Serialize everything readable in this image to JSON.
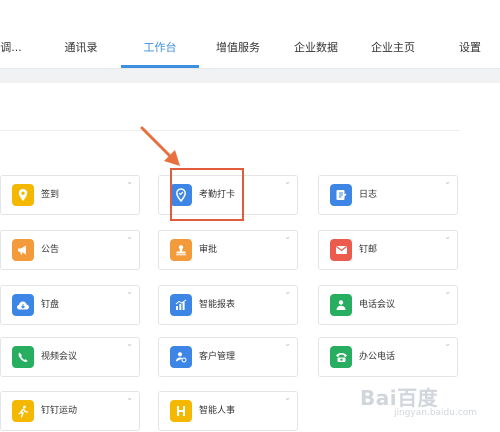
{
  "nav": {
    "items": [
      {
        "label": "调..."
      },
      {
        "label": "通讯录"
      },
      {
        "label": "工作台",
        "active": true
      },
      {
        "label": "增值服务"
      },
      {
        "label": "企业数据"
      },
      {
        "label": "企业主页"
      },
      {
        "label": "设置"
      }
    ]
  },
  "apps": [
    {
      "label": "签到",
      "icon": "location-pin-icon",
      "color": "#f5b800"
    },
    {
      "label": "考勤打卡",
      "icon": "attendance-pin-icon",
      "color": "#3e86e6"
    },
    {
      "label": "日志",
      "icon": "log-note-icon",
      "color": "#3e86e6"
    },
    {
      "label": "公告",
      "icon": "megaphone-icon",
      "color": "#f39a3b"
    },
    {
      "label": "审批",
      "icon": "stamp-icon",
      "color": "#f39a3b"
    },
    {
      "label": "钉邮",
      "icon": "mail-icon",
      "color": "#eb5b4e"
    },
    {
      "label": "钉盘",
      "icon": "cloud-drive-icon",
      "color": "#3e86e6"
    },
    {
      "label": "智能报表",
      "icon": "bar-chart-icon",
      "color": "#3e86e6"
    },
    {
      "label": "电话会议",
      "icon": "conference-call-icon",
      "color": "#27ae60"
    },
    {
      "label": "视频会议",
      "icon": "video-call-icon",
      "color": "#27ae60"
    },
    {
      "label": "客户管理",
      "icon": "customer-icon",
      "color": "#3e86e6"
    },
    {
      "label": "办公电话",
      "icon": "office-phone-icon",
      "color": "#27ae60"
    },
    {
      "label": "钉钉运动",
      "icon": "runner-icon",
      "color": "#f5b800"
    },
    {
      "label": "智能人事",
      "icon": "hr-icon",
      "color": "#f5b800"
    }
  ],
  "watermark": {
    "brand": "Bai百度",
    "sub": "jingyan.baidu.com"
  }
}
